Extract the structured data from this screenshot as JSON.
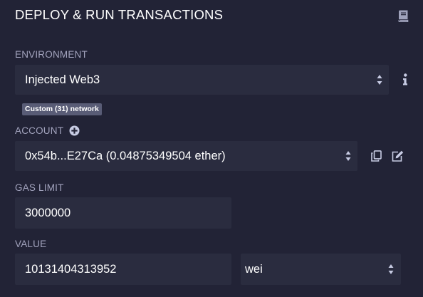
{
  "panel": {
    "title": "DEPLOY & RUN TRANSACTIONS"
  },
  "environment": {
    "label": "ENVIRONMENT",
    "selected": "Injected Web3",
    "network_badge": "Custom (31) network"
  },
  "account": {
    "label": "ACCOUNT",
    "selected": "0x54b...E27Ca (0.04875349504 ether)"
  },
  "gas_limit": {
    "label": "GAS LIMIT",
    "value": "3000000"
  },
  "value": {
    "label": "VALUE",
    "amount": "10131404313952",
    "unit": "wei"
  },
  "icons": {
    "docs": "book-icon",
    "info": "info-icon",
    "add_account": "plus-circle-icon",
    "copy": "copy-icon",
    "edit": "edit-icon"
  },
  "colors": {
    "background": "#222336",
    "field": "#2a2c3f",
    "label": "#a2a3bd",
    "badge": "#595c76"
  }
}
